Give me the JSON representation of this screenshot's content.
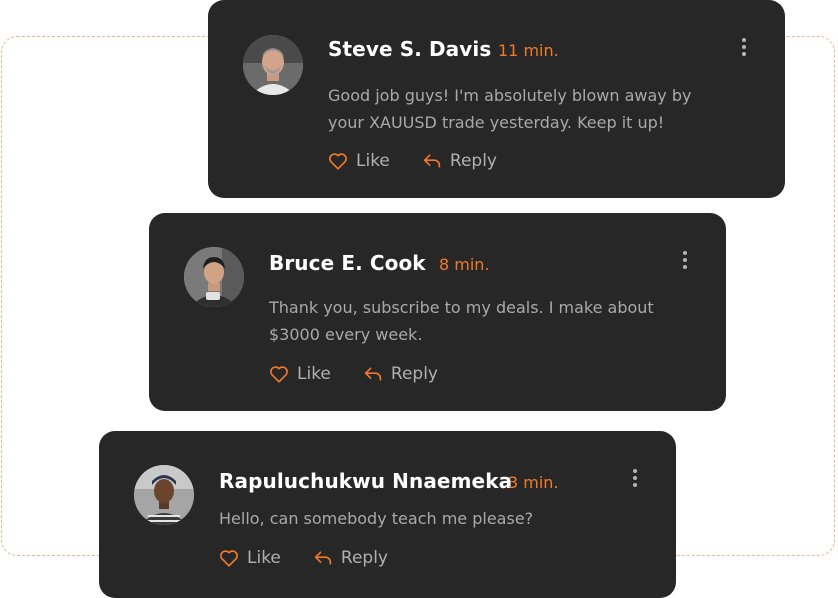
{
  "colors": {
    "card_bg": "#272727",
    "accent": "#f17a2a",
    "name": "#ffffff",
    "message": "#a9a9a9",
    "action_text": "#b0b0b0",
    "dashed_border": "#f0b48c"
  },
  "comments": [
    {
      "author": "Steve S. Davis",
      "time": "11 min.",
      "message": "Good job guys! I'm absolutely blown away by your XAUUSD trade yesterday. Keep it up!",
      "like_label": "Like",
      "reply_label": "Reply",
      "avatar_icon": "avatar-photo",
      "like_icon": "heart-icon",
      "reply_icon": "reply-arrow-icon",
      "menu_icon": "more-vertical-icon"
    },
    {
      "author": "Bruce E. Cook",
      "time": "8 min.",
      "message": "Thank you, subscribe to my deals. I make about $3000 every week.",
      "like_label": "Like",
      "reply_label": "Reply",
      "avatar_icon": "avatar-photo",
      "like_icon": "heart-icon",
      "reply_icon": "reply-arrow-icon",
      "menu_icon": "more-vertical-icon"
    },
    {
      "author": "Rapuluchukwu Nnaemeka",
      "time": "3 min.",
      "message": "Hello, can somebody teach me please?",
      "like_label": "Like",
      "reply_label": "Reply",
      "avatar_icon": "avatar-photo",
      "like_icon": "heart-icon",
      "reply_icon": "reply-arrow-icon",
      "menu_icon": "more-vertical-icon"
    }
  ]
}
